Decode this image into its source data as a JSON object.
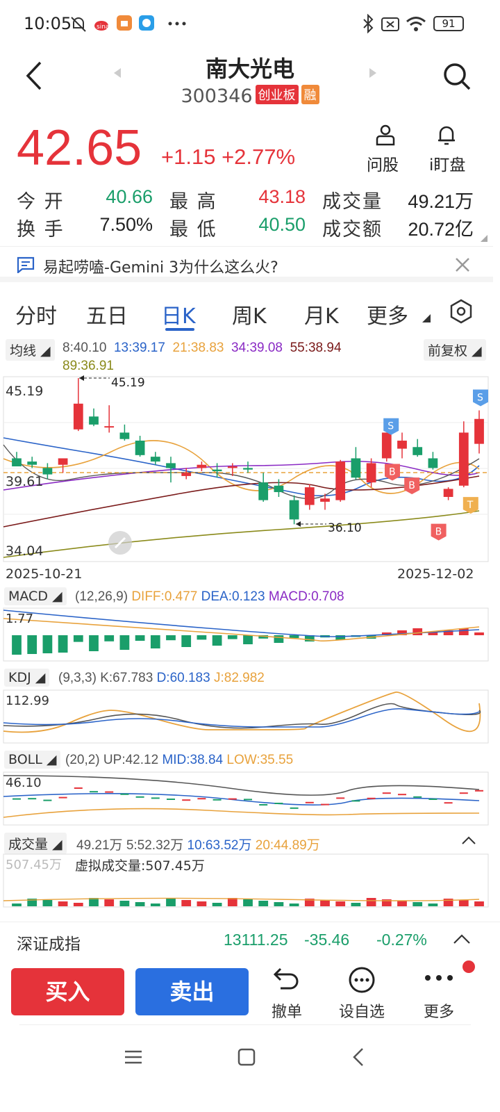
{
  "status_bar": {
    "time": "10:05",
    "battery": "91"
  },
  "header": {
    "title": "南大光电",
    "code": "300346",
    "board_tag": "创业板",
    "margin_tag": "融"
  },
  "quote": {
    "price": "42.65",
    "change": "+1.15",
    "change_pct": "+2.77%",
    "ask_label": "问股",
    "watch_label": "i盯盘",
    "stats": [
      {
        "label": "今 开",
        "value": "40.66",
        "color": "green"
      },
      {
        "label": "最 高",
        "value": "43.18",
        "color": "red"
      },
      {
        "label": "成交量",
        "value": "49.21万",
        "color": "dark"
      },
      {
        "label": "换 手",
        "value": "7.50%",
        "color": "dark"
      },
      {
        "label": "最 低",
        "value": "40.50",
        "color": "green"
      },
      {
        "label": "成交额",
        "value": "20.72亿",
        "color": "dark"
      }
    ]
  },
  "notice": {
    "text": "易起唠嗑-Gemini 3为什么这么火?"
  },
  "tabs": [
    "分时",
    "五日",
    "日K",
    "周K",
    "月K",
    "更多"
  ],
  "ma": {
    "label": "均线",
    "adjust": "前复权",
    "items": [
      "8:40.10",
      "13:39.17",
      "21:38.83",
      "34:39.08",
      "55:38.94",
      "89:36.91"
    ]
  },
  "chart_data": {
    "type": "candlestick",
    "y_max_label": "45.19",
    "y_mid_label": "39.61",
    "y_min_label": "34.04",
    "ylim": [
      34.04,
      45.19
    ],
    "high_marker": "45.19",
    "low_marker": "36.10",
    "x_start": "2025-10-21",
    "x_end": "2025-12-02",
    "candles": [
      [
        40.2,
        40.6,
        39.8,
        39.7
      ],
      [
        40.0,
        40.3,
        39.6,
        39.8
      ],
      [
        39.6,
        39.9,
        38.9,
        39.2
      ],
      [
        39.8,
        40.1,
        39.3,
        40.2
      ],
      [
        42.0,
        45.19,
        41.9,
        43.6
      ],
      [
        42.8,
        43.3,
        42.2,
        42.3
      ],
      [
        42.2,
        43.5,
        41.8,
        42.2
      ],
      [
        41.8,
        42.3,
        41.3,
        41.4
      ],
      [
        41.3,
        41.6,
        40.3,
        40.4
      ],
      [
        40.3,
        40.6,
        39.8,
        40.0
      ],
      [
        39.9,
        40.3,
        38.7,
        39.6
      ],
      [
        39.1,
        39.6,
        38.9,
        39.3
      ],
      [
        39.6,
        40.0,
        39.4,
        39.8
      ],
      [
        39.5,
        39.9,
        39.0,
        39.4
      ],
      [
        39.6,
        39.9,
        39.1,
        39.7
      ],
      [
        39.6,
        40.0,
        39.3,
        39.5
      ],
      [
        38.7,
        39.3,
        37.5,
        37.6
      ],
      [
        38.5,
        38.9,
        37.8,
        38.1
      ],
      [
        37.6,
        37.9,
        36.1,
        36.4
      ],
      [
        37.3,
        38.6,
        37.0,
        38.4
      ],
      [
        37.5,
        38.0,
        37.0,
        37.7
      ],
      [
        37.6,
        40.1,
        37.5,
        40.0
      ],
      [
        40.2,
        40.9,
        38.9,
        39.0
      ],
      [
        38.7,
        40.2,
        38.4,
        39.9
      ],
      [
        40.2,
        41.8,
        40.0,
        41.8
      ],
      [
        40.8,
        41.8,
        40.2,
        41.3
      ],
      [
        40.9,
        41.4,
        40.3,
        40.4
      ],
      [
        40.2,
        40.6,
        39.5,
        39.6
      ],
      [
        37.8,
        38.4,
        37.6,
        38.3
      ],
      [
        38.5,
        42.5,
        38.4,
        41.8
      ],
      [
        41.1,
        43.18,
        40.5,
        42.65
      ]
    ],
    "signals": [
      {
        "label": "S",
        "index": 30
      },
      {
        "label": "S",
        "index": 26
      },
      {
        "label": "B",
        "index": 25
      },
      {
        "label": "B",
        "index": 26
      },
      {
        "label": "B",
        "index": 28
      },
      {
        "label": "T",
        "index": 29
      }
    ]
  },
  "macd": {
    "label": "MACD",
    "params": "(12,26,9)",
    "diff": "DIFF:0.477",
    "dea": "DEA:0.123",
    "macd": "MACD:0.708",
    "y_label": "1.77"
  },
  "kdj": {
    "label": "KDJ",
    "params": "(9,3,3)",
    "k": "K:67.783",
    "d": "D:60.183",
    "j": "J:82.982",
    "y_label": "112.99"
  },
  "boll": {
    "label": "BOLL",
    "params": "(20,2)",
    "up": "UP:42.12",
    "mid": "MID:38.84",
    "low": "LOW:35.55",
    "y_label": "46.10"
  },
  "volume": {
    "label": "成交量",
    "current": "49.21万",
    "ma5": "5:52.32万",
    "ma10": "10:63.52万",
    "ma20": "20:44.89万",
    "y_label": "507.45万",
    "virtual": "虚拟成交量:507.45万"
  },
  "index_bar": {
    "name": "深证成指",
    "value": "13111.25",
    "change": "-35.46",
    "pct": "-0.27%"
  },
  "actions": {
    "buy": "买入",
    "sell": "卖出",
    "cancel": "撤单",
    "watch": "设自选",
    "more": "更多"
  }
}
